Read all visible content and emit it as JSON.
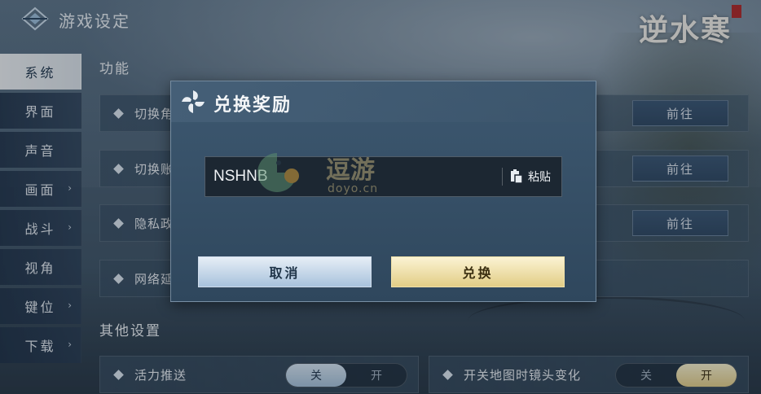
{
  "header": {
    "title": "游戏设定",
    "game_logo_text": "逆水寒"
  },
  "nav": {
    "items": [
      {
        "label": "系统",
        "active": true,
        "has_arrow": false
      },
      {
        "label": "界面",
        "active": false,
        "has_arrow": false
      },
      {
        "label": "声音",
        "active": false,
        "has_arrow": false
      },
      {
        "label": "画面",
        "active": false,
        "has_arrow": true
      },
      {
        "label": "战斗",
        "active": false,
        "has_arrow": true
      },
      {
        "label": "视角",
        "active": false,
        "has_arrow": false
      },
      {
        "label": "键位",
        "active": false,
        "has_arrow": true
      },
      {
        "label": "下载",
        "active": false,
        "has_arrow": true
      }
    ],
    "arrow_glyph": "›"
  },
  "sections": {
    "function_title": "功能",
    "other_title": "其他设置"
  },
  "function_rows": [
    {
      "label": "切换角",
      "button": "前往"
    },
    {
      "label": "切换账",
      "button": "前往"
    },
    {
      "label": "隐私政",
      "button": "前往"
    },
    {
      "label": "网络延",
      "button": ""
    }
  ],
  "other_rows": [
    {
      "label": "活力推送",
      "off_label": "关",
      "on_label": "开",
      "selected": "off"
    },
    {
      "label": "开关地图时镜头变化",
      "off_label": "关",
      "on_label": "开",
      "selected": "on"
    }
  ],
  "modal": {
    "title": "兑换奖励",
    "code_value": "NSHNB",
    "paste_label": "粘贴",
    "cancel_label": "取消",
    "confirm_label": "兑换"
  },
  "watermark": {
    "text": "逗游",
    "sub": "doyo.cn"
  },
  "colors": {
    "accent_gold": "#e5d08a",
    "accent_blue": "#a9c4dc",
    "panel": "#2f475d"
  }
}
